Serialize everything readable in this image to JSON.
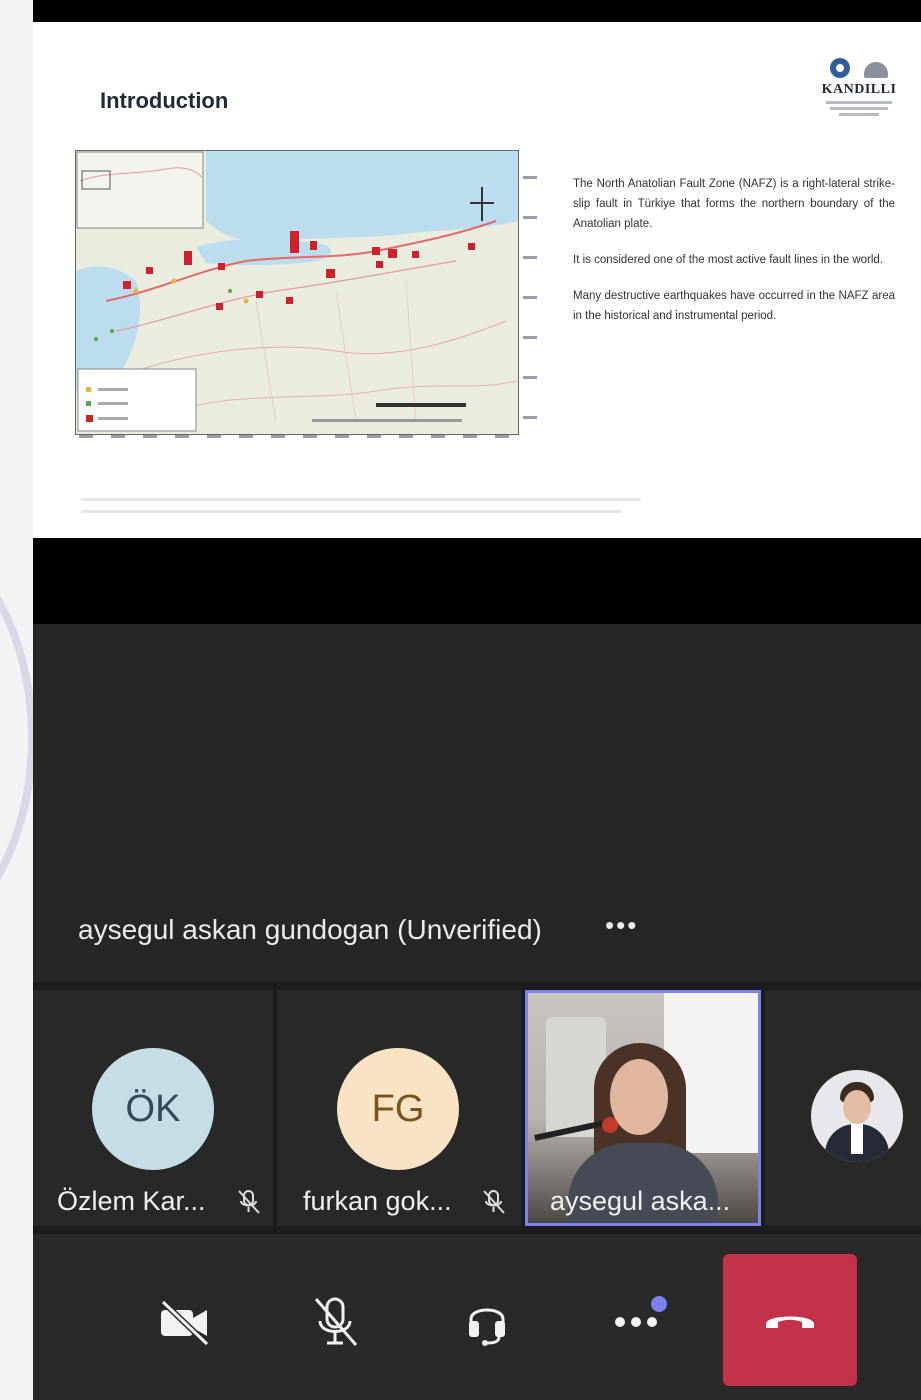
{
  "slide": {
    "title": "Introduction",
    "logo_text": "KANDILLI",
    "paragraphs": [
      "The North Anatolian Fault Zone (NAFZ) is a right-lateral strike-slip fault in Türkiye that forms the northern boundary of the Anatolian plate.",
      "It is considered one of the most active fault lines in the world.",
      "Many destructive earthquakes have occurred in the NAFZ area in the historical and instrumental period."
    ]
  },
  "stage": {
    "speaker_name": "aysegul askan gundogan (Unverified)",
    "more_label": "•••"
  },
  "participants": [
    {
      "initials": "ÖK",
      "name": "Özlem  Kar...",
      "muted": true
    },
    {
      "initials": "FG",
      "name": "furkan gok...",
      "muted": true
    },
    {
      "initials": "",
      "name": "aysegul aska...",
      "muted": false,
      "video": true,
      "active_speaker": true
    },
    {
      "initials": "",
      "name": "",
      "photo": true
    }
  ],
  "controls": {
    "camera_icon": "camera-off-icon",
    "mic_icon": "mic-off-icon",
    "audio_icon": "headset-icon",
    "more_icon": "more-actions-icon",
    "hangup_icon": "hang-up-icon"
  },
  "colors": {
    "accent": "#7b83eb",
    "hangup": "#c4314b",
    "stage_bg": "#262626",
    "avatar_ok": "#c7dde6",
    "avatar_fg": "#f8e4c5"
  }
}
